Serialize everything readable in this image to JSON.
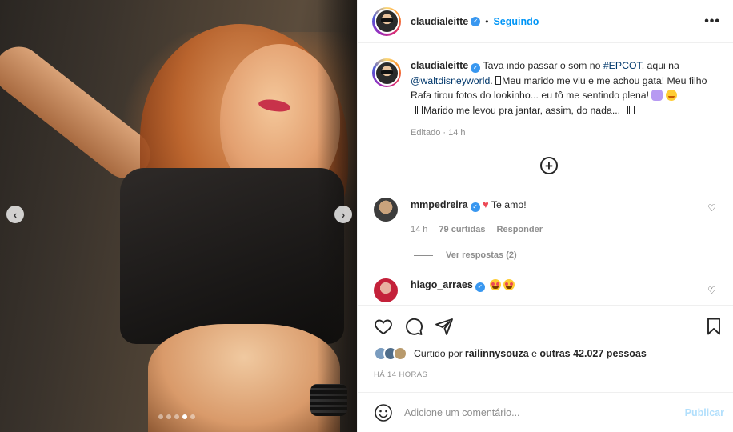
{
  "photo": {
    "prev_arrow": "‹",
    "next_arrow": "›",
    "dot_count": 5,
    "active_dot": 4
  },
  "header": {
    "username": "claudialeitte",
    "separator": "•",
    "follow_status": "Seguindo",
    "more_label": "•••"
  },
  "caption": {
    "username": "claudialeitte",
    "text_1": "Tava indo passar o som no ",
    "tag_1": "#EPCOT",
    "text_2": ", aqui na ",
    "tag_2": "@waltdisneyworld",
    "text_3": ". ",
    "text_4": "Meu marido me viu e me achou gata! Meu filho Rafa tirou fotos do lookinho... eu tô me sentindo plena! ",
    "text_5": "Marido me levou pra jantar, assim, do nada... ",
    "meta": "Editado · 14 h"
  },
  "load_more": "+",
  "comments": [
    {
      "username": "mmpedreira",
      "text": "Te amo!",
      "time": "14 h",
      "likes": "79 curtidas",
      "reply": "Responder",
      "view_replies": "Ver respostas (2)"
    },
    {
      "username": "hiago_arraes",
      "text": ""
    }
  ],
  "likes": {
    "prefix": "Curtido por ",
    "user": "railinnysouza",
    "middle": " e ",
    "others": "outras 42.027 pessoas"
  },
  "timestamp": "HÁ 14 HORAS",
  "add_comment": {
    "placeholder": "Adicione um comentário...",
    "publish": "Publicar"
  },
  "colors": {
    "accent": "#0095f6",
    "link": "#00376b",
    "muted": "#8e8e8e",
    "verified": "#3897f0",
    "heart": "#ed4956",
    "publish_disabled": "#b2dffc"
  }
}
